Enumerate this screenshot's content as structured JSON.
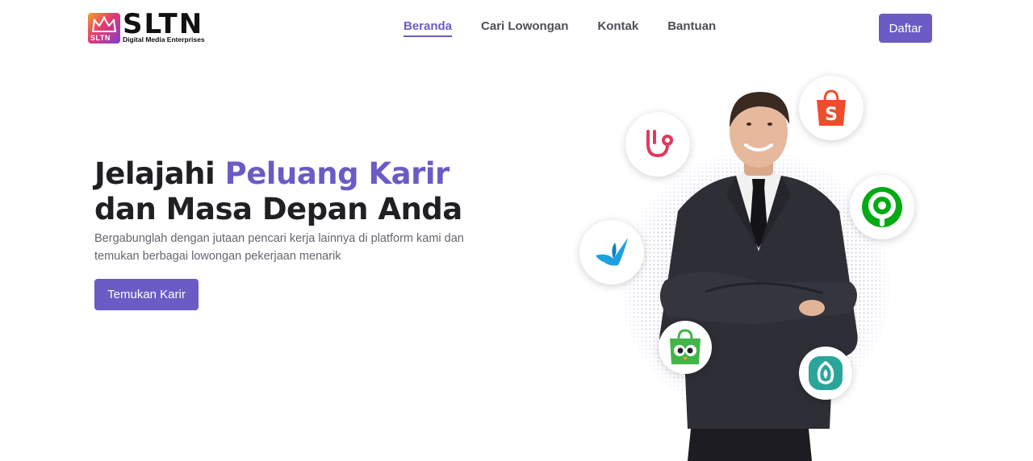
{
  "brand": {
    "name": "SLTN",
    "mark_text": "SLTN",
    "tagline": "Digital Media Enterprises"
  },
  "nav": {
    "items": [
      {
        "label": "Beranda",
        "active": true
      },
      {
        "label": "Cari Lowongan",
        "active": false
      },
      {
        "label": "Kontak",
        "active": false
      },
      {
        "label": "Bantuan",
        "active": false
      }
    ],
    "cta_label": "Daftar"
  },
  "hero": {
    "title_part1": "Jelajahi ",
    "title_accent": "Peluang Karir",
    "title_line2": "dan Masa Depan Anda",
    "subtitle": "Bergabunglah dengan jutaan pencari kerja lainnya di platform kami dan temukan berbagai lowongan pekerjaan menarik",
    "button_label": "Temukan Karir"
  },
  "app_icons": [
    {
      "name": "stethoscope-icon",
      "color": "#e03a5f"
    },
    {
      "name": "shopee-bag-icon",
      "color": "#ee4d2d"
    },
    {
      "name": "gojek-icon",
      "color": "#00aa13"
    },
    {
      "name": "traveloka-bird-icon",
      "color": "#1ba0e2"
    },
    {
      "name": "tokopedia-owl-icon",
      "color": "#42b549"
    },
    {
      "name": "halodoc-leaf-icon",
      "color": "#2aa59a"
    }
  ],
  "colors": {
    "accent": "#6a5cc4",
    "text_dark": "#1f1f24",
    "text_muted": "#666670"
  }
}
